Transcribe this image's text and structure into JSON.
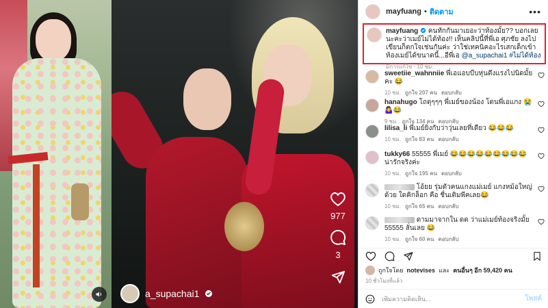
{
  "reel": {
    "likes": "977",
    "comments": "3",
    "username": "a_supachai1"
  },
  "post": {
    "username": "mayfuang",
    "dot": "•",
    "follow": "ติดตาม",
    "more": "•••"
  },
  "caption": {
    "username": "mayfuang",
    "text": "คนทักกันมาเยอะว่าท้องมั้ย?? บอกเลยนะคะว่าเมย์ไม่ได้ท้อง!! เห็นคลิปนี้ที่พี่เอ ศุภชัย ลงไปเขียนก็ตกใจเช่นกันค่ะ ว่าใช่เทคนิคอะไรเสกเด็กเข้าท้องเมย์ได้ขนาดนี้...อีพี่เอ",
    "mention": "@a_supachai1",
    "hashtag": "#ไม่ได้ท้อง",
    "meta": "มีการแก้ไข · 10 ชม."
  },
  "comments": [
    {
      "username": "sweetiie_wahnniie",
      "text": "พี่เอแอบบีบหุ่นดึงแรงไปนิดมั้ยคะ 😂",
      "time": "10 ชม.",
      "likes": "ถูกใจ 207 คน",
      "reply": "ตอบกลับ"
    },
    {
      "username": "hanahugo",
      "text": "โถดุๆๆๆ พี่เมย์ของน้อง โดนพี่เอแกง 😭🤷‍♀️😂",
      "time": "9 ชม.",
      "likes": "ถูกใจ 134 คน",
      "reply": "ตอบกลับ"
    },
    {
      "username": "lilisa_li",
      "text": "พี่เมย์ยิ่งกับว่าวุ่นเลยที่เดียว 😂😂😂",
      "time": "10 ชม.",
      "likes": "ถูกใจ 83 คน",
      "reply": "ตอบกลับ"
    },
    {
      "username": "tukky66",
      "text": "55555 พี่เมย์ 😂😂😂😂😂😂😂😂😂 น่ารักจริงค่ะ",
      "time": "10 ชม.",
      "likes": "ถูกใจ 195 คน",
      "reply": "ตอบกลับ"
    },
    {
      "username": "",
      "text": "โอ้ยย รุ่มตัวคนแกงแม่เมย์ แกงหม้อใหญ่ด้วย ใดคิกล็อก คือ ชื่นเติมพีคเลย😂",
      "time": "10 ชม.",
      "likes": "ถูกใจ 65 คน",
      "reply": "ตอบกลับ"
    },
    {
      "username": "",
      "text": "ดามมาจากใน ดด ว่าแม่เมย์ท้องจริงมั้ย 55555 ลั่นเลย 😂",
      "time": "10 ชม.",
      "likes": "ถูกใจ 60 คน",
      "reply": "ตอบกลับ"
    }
  ],
  "likes_line": {
    "prefix": "ถูกใจโดย",
    "user": "notevises",
    "middle": "และ",
    "others": "คนอื่นๆ อีก 59,420 คน"
  },
  "time_ago": "10 ชั่วโมงที่แล้ว",
  "add_comment": {
    "placeholder": "เพิ่มความคิดเห็น...",
    "post": "โพสต์"
  },
  "icons": {
    "sound": "speaker-icon",
    "like": "heart-icon",
    "comment": "comment-icon",
    "share": "send-icon",
    "save": "bookmark-icon",
    "emoji": "emoji-icon"
  },
  "colors": {
    "highlight_border": "#e0212f",
    "follow_blue": "#0095f6",
    "mention_blue": "#00376b"
  }
}
